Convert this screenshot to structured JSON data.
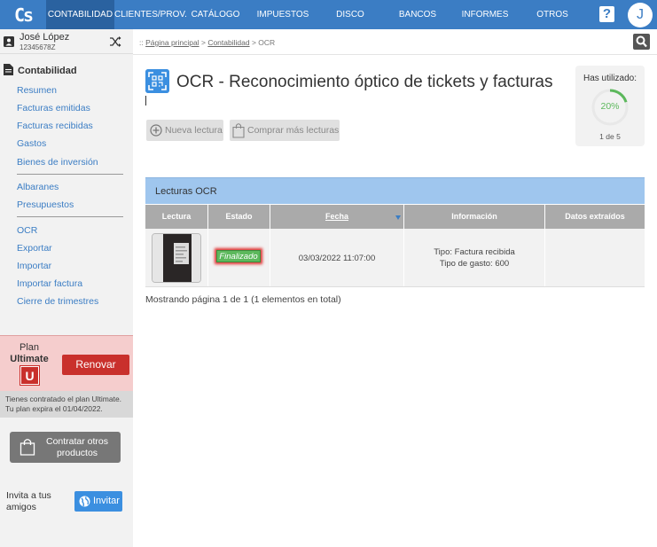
{
  "nav": {
    "logo": "Cs",
    "items": [
      {
        "label": "CONTABILIDAD",
        "active": true
      },
      {
        "label": "CLIENTES/PROV."
      },
      {
        "label": "CATÁLOGO"
      },
      {
        "label": "IMPUESTOS"
      },
      {
        "label": "DISCO VIRTUAL"
      },
      {
        "label": "BANCOS"
      },
      {
        "label": "INFORMES"
      },
      {
        "label": "OTROS"
      }
    ],
    "help": "?",
    "avatar_initial": "J"
  },
  "sidebar": {
    "user_name": "José López",
    "user_id": "12345678Z",
    "section_title": "Contabilidad",
    "group1": [
      "Resumen",
      "Facturas emitidas",
      "Facturas recibidas",
      "Gastos",
      "Bienes de inversión"
    ],
    "group2": [
      "Albaranes",
      "Presupuestos"
    ],
    "group3": [
      "OCR",
      "Exportar",
      "Importar",
      "Importar factura",
      "Cierre de trimestres"
    ],
    "plan_label": "Plan",
    "plan_name": "Ultimate",
    "plan_letter": "U",
    "renew_label": "Renovar",
    "plan_note_1": "Tienes contratado el plan Ultimate.",
    "plan_note_2": "Tu plan expira el 01/04/2022.",
    "contract_label": "Contratar otros productos",
    "invite_text": "Invita a tus amigos",
    "invite_button": "Invitar"
  },
  "breadcrumb": {
    "prefix": "::",
    "home": "Página principal",
    "section": "Contabilidad",
    "current": "OCR",
    "sep": ">"
  },
  "main": {
    "title": "OCR - Reconocimiento óptico de tickets y facturas",
    "new_reading": "Nueva lectura",
    "buy_more": "Comprar más lecturas",
    "usage_label": "Has utilizado:",
    "usage_percent": "20%",
    "usage_fraction": 0.2,
    "usage_count": "1 de 5",
    "table_title": "Lecturas OCR",
    "columns": [
      "Lectura",
      "Estado",
      "Fecha",
      "Información",
      "Datos extraídos"
    ],
    "row": {
      "status": "Finalizado",
      "date": "03/03/2022 11:07:00",
      "info_type": "Tipo: Factura recibida",
      "info_expense": "Tipo de gasto: 600",
      "extracted": ""
    },
    "pagination": "Mostrando página 1 de 1 (1 elementos en total)"
  },
  "colors": {
    "nav_bg": "#3b7dc4",
    "nav_active": "#2a62a0",
    "link": "#3b7dc4",
    "danger": "#c9302c",
    "success": "#5cb85c",
    "table_head": "#9fc6ee"
  }
}
